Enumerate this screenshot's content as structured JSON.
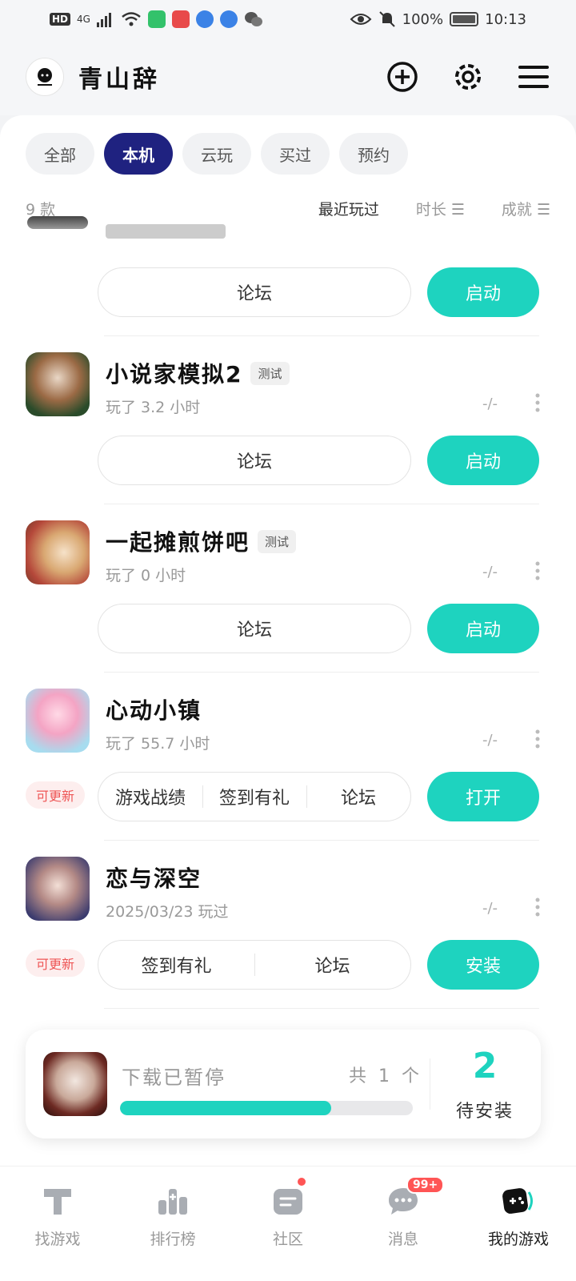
{
  "status_bar": {
    "left": {
      "hd": "HD",
      "network": "4G"
    },
    "right": {
      "battery": "100%",
      "time": "10:13"
    }
  },
  "header": {
    "username": "青山辞"
  },
  "filters": {
    "tabs": [
      {
        "label": "全部",
        "active": false
      },
      {
        "label": "本机",
        "active": true
      },
      {
        "label": "云玩",
        "active": false
      },
      {
        "label": "买过",
        "active": false
      },
      {
        "label": "预约",
        "active": false
      }
    ]
  },
  "list_meta": {
    "count": "9 款",
    "sorts": [
      {
        "label": "最近玩过",
        "active": true
      },
      {
        "label": "时长 ☰",
        "active": false
      },
      {
        "label": "成就 ☰",
        "active": false
      }
    ]
  },
  "partial_game": {
    "forum": "论坛",
    "primary": "启动"
  },
  "games": [
    {
      "title": "小说家模拟2",
      "tag": "测试",
      "subtitle": "玩了 3.2 小时",
      "rating": "-/-",
      "update_badge": "",
      "actions": [
        "论坛"
      ],
      "primary": "启动"
    },
    {
      "title": "一起摊煎饼吧",
      "tag": "测试",
      "subtitle": "玩了 0 小时",
      "rating": "-/-",
      "update_badge": "",
      "actions": [
        "论坛"
      ],
      "primary": "启动"
    },
    {
      "title": "心动小镇",
      "tag": "",
      "subtitle": "玩了 55.7 小时",
      "rating": "-/-",
      "update_badge": "可更新",
      "actions": [
        "游戏战绩",
        "签到有礼",
        "论坛"
      ],
      "primary": "打开"
    },
    {
      "title": "恋与深空",
      "tag": "",
      "subtitle": "2025/03/23 玩过",
      "rating": "-/-",
      "update_badge": "可更新",
      "actions": [
        "签到有礼",
        "论坛"
      ],
      "primary": "安装"
    }
  ],
  "download": {
    "title": "下载已暂停",
    "count": "共 1 个",
    "progress": 0.72,
    "pending_number": "2",
    "pending_label": "待安装"
  },
  "bottom_nav": {
    "items": [
      {
        "label": "找游戏",
        "active": false
      },
      {
        "label": "排行榜",
        "active": false
      },
      {
        "label": "社区",
        "active": false
      },
      {
        "label": "消息",
        "active": false,
        "badge": "99+"
      },
      {
        "label": "我的游戏",
        "active": true
      }
    ]
  },
  "colors": {
    "accent": "#1ed3bf",
    "active_tab": "#1f2280",
    "badge_red": "#ff5555"
  }
}
